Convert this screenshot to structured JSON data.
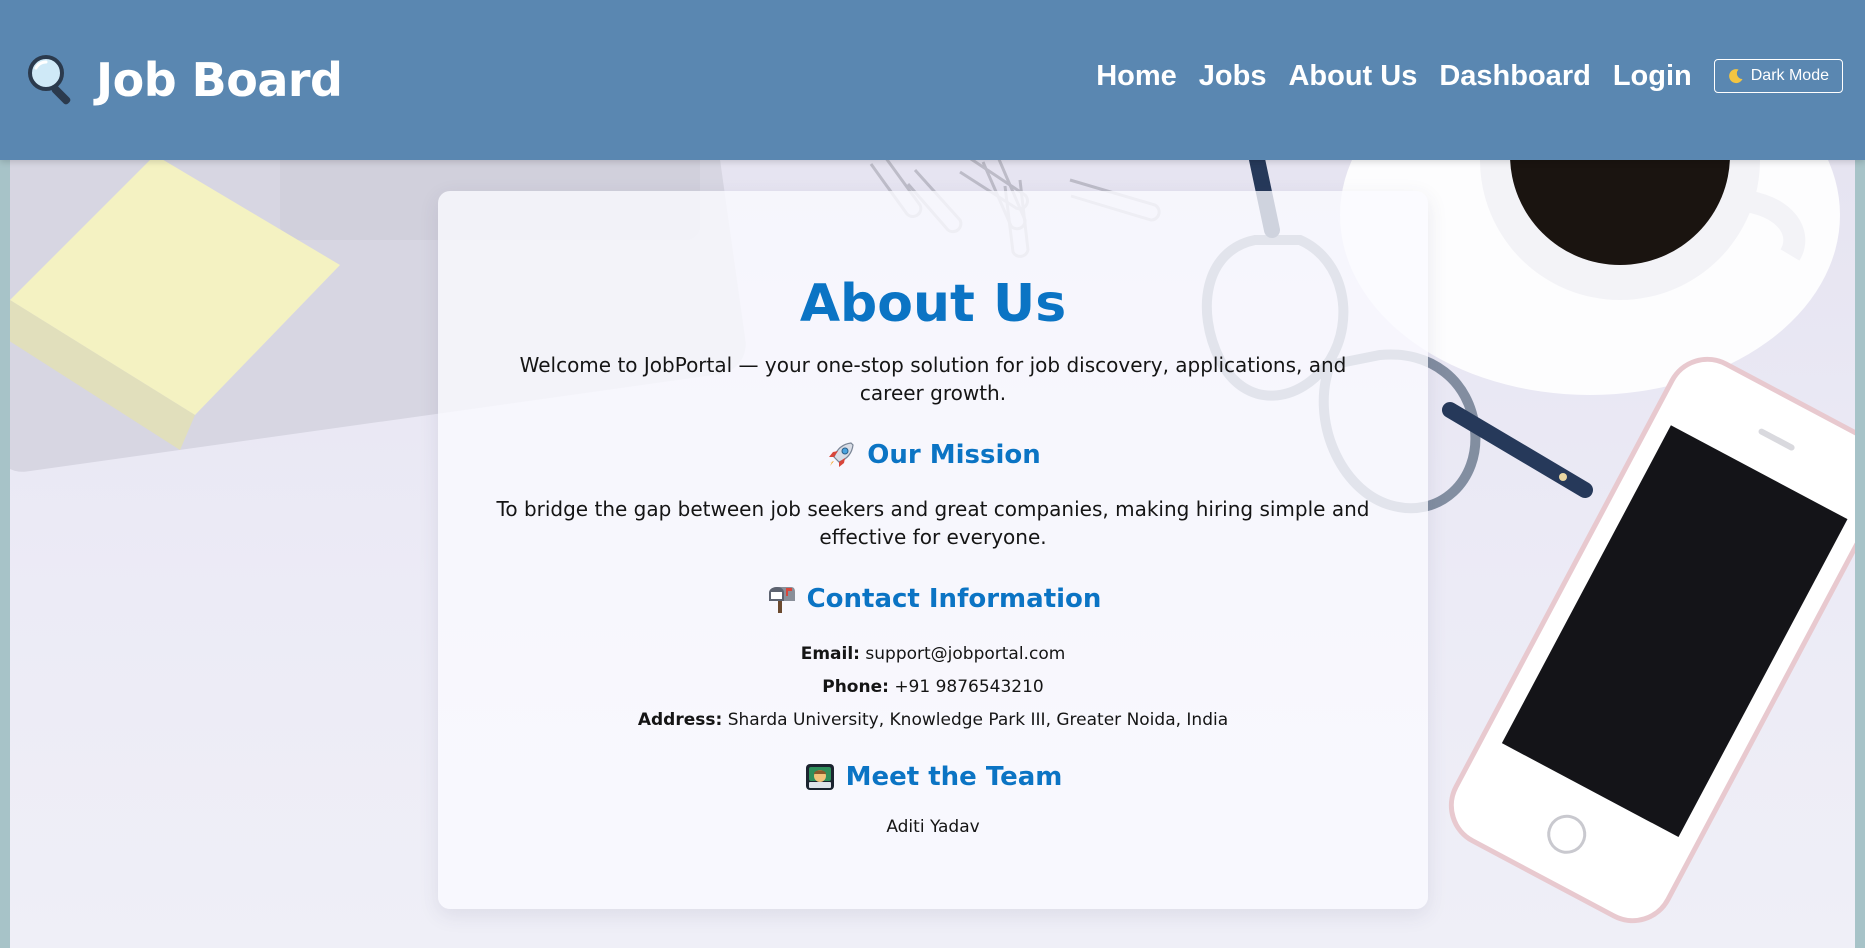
{
  "header": {
    "brand_icon": "magnifier-icon",
    "brand_title": "Job Board",
    "nav": [
      {
        "label": "Home"
      },
      {
        "label": "Jobs"
      },
      {
        "label": "About Us"
      },
      {
        "label": "Dashboard"
      },
      {
        "label": "Login"
      }
    ],
    "dark_mode": {
      "icon": "moon-icon",
      "label": "Dark Mode"
    },
    "colors": {
      "header_bg": "#5a87b1",
      "text": "#ffffff"
    }
  },
  "about": {
    "title": "About Us",
    "intro": "Welcome to JobPortal — your one-stop solution for job discovery, applications, and career growth.",
    "mission": {
      "icon": "rocket-icon",
      "title": "Our Mission",
      "text": "To bridge the gap between job seekers and great companies, making hiring simple and effective for everyone."
    },
    "contact": {
      "icon": "mailbox-icon",
      "title": "Contact Information",
      "email_label": "Email:",
      "email": "support@jobportal.com",
      "phone_label": "Phone:",
      "phone": "+91 9876543210",
      "address_label": "Address:",
      "address": "Sharda University, Knowledge Park III, Greater Noida, India"
    },
    "team": {
      "icon": "technologist-icon",
      "title": "Meet the Team",
      "members": [
        "Aditi Yadav"
      ]
    },
    "colors": {
      "heading": "#0b74c4",
      "body_text": "#151515"
    }
  }
}
